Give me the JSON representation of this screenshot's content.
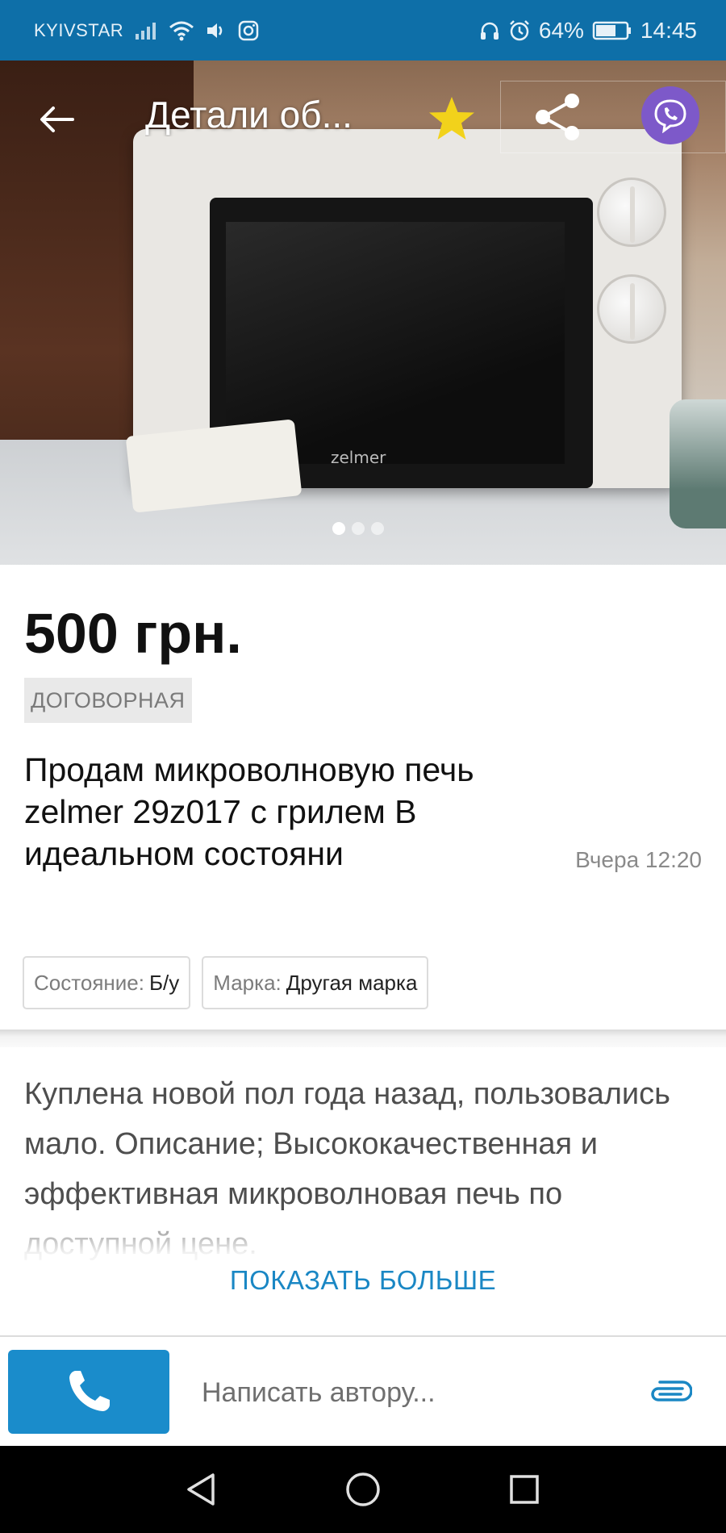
{
  "status_bar": {
    "carrier": "KYIVSTAR",
    "battery": "64%",
    "time": "14:45",
    "icons": [
      "signal-icon",
      "wifi-icon",
      "volume-icon",
      "instagram-icon",
      "headphones-icon",
      "alarm-icon",
      "battery-icon"
    ]
  },
  "header": {
    "title": "Детали об...",
    "back_icon": "back-arrow-icon",
    "favorite_icon": "star-icon",
    "share_icon": "share-icon",
    "viber_icon": "viber-icon",
    "favorite_color": "#f2d21b"
  },
  "gallery": {
    "image_count": 3,
    "active_index": 0,
    "image_description": "microwave photo",
    "brand_on_device": "zelmer"
  },
  "listing": {
    "price": "500 грн.",
    "negotiable_label": "ДОГОВОРНАЯ",
    "title": "Продам микроволновую печь zelmer 29z017 с грилем В идеальном состояни",
    "posted_time": "Вчера 12:20",
    "params": [
      {
        "key": "Состояние:",
        "value": "Б/у"
      },
      {
        "key": "Марка:",
        "value": "Другая марка"
      }
    ],
    "description": "Куплена новой пол года назад, пользовались мало. Описание; Высококачественная и эффективная микроволновая печь по доступной цене.",
    "show_more_label": "ПОКАЗАТЬ БОЛЬШЕ"
  },
  "message_bar": {
    "call_icon": "phone-icon",
    "input_placeholder": "Написать автору...",
    "attach_icon": "paperclip-icon"
  },
  "nav_bar": {
    "back_icon": "nav-back-icon",
    "home_icon": "nav-home-icon",
    "recents_icon": "nav-recents-icon"
  },
  "colors": {
    "status_bar": "#0e6fa8",
    "accent": "#1a8ccb",
    "link": "#1a87c4",
    "viber": "#7d59c9"
  }
}
